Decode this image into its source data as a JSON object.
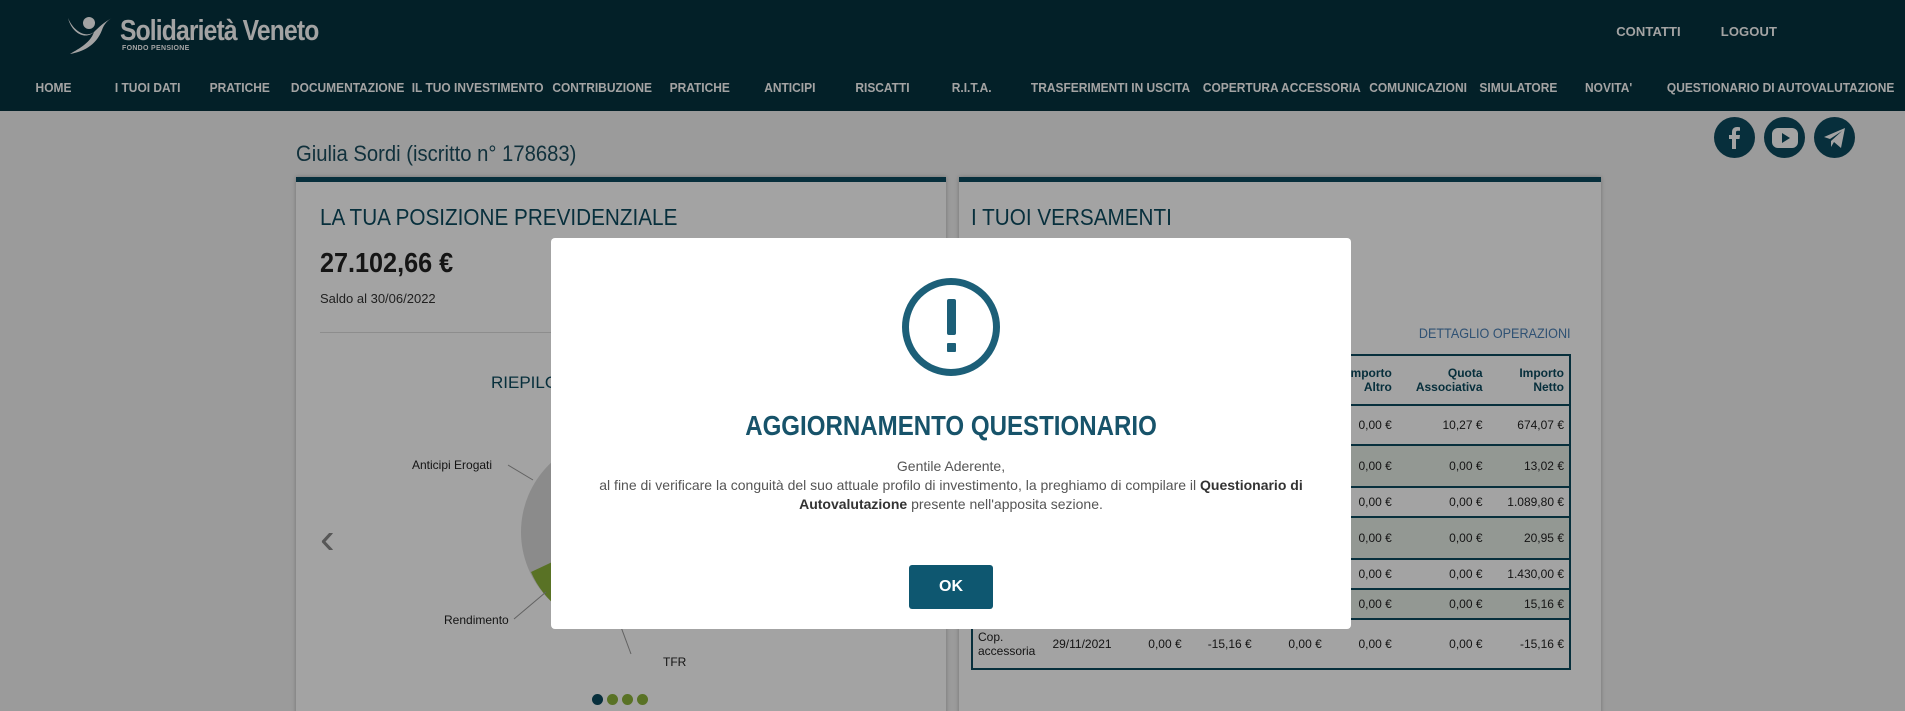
{
  "brand": {
    "name": "Solidarietà Veneto",
    "subtitle": "FONDO PENSIONE"
  },
  "top_links": [
    "CONTATTI",
    "LOGOUT"
  ],
  "nav": [
    "HOME",
    "I TUOI DATI",
    "PRATICHE",
    "DOCUMENTAZIONE",
    "IL TUO INVESTIMENTO",
    "CONTRIBUZIONE",
    "PRATICHE",
    "ANTICIPI",
    "RISCATTI",
    "R.I.T.A.",
    "TRASFERIMENTI IN USCITA",
    "COPERTURA ACCESSORIA",
    "COMUNICAZIONI",
    "SIMULATORE",
    "NOVITA'",
    "QUESTIONARIO DI AUTOVALUTAZIONE"
  ],
  "user": {
    "name": "Giulia Sordi (iscritto n° 178683)"
  },
  "social": [
    "facebook-icon",
    "youtube-icon",
    "telegram-icon"
  ],
  "position": {
    "title": "LA TUA POSIZIONE PREVIDENZIALE",
    "balance": "27.102,66  €",
    "date": "Saldo al 30/06/2022",
    "recap": "RIEPILOG",
    "chart_labels": [
      "Anticipi Erogati",
      "Rendimento",
      "TFR"
    ]
  },
  "payments": {
    "title": "I TUOI VERSAMENTI",
    "detail_link": "DETTAGLIO OPERAZIONI",
    "headers": [
      "Importo Altro",
      "Quota Associativa",
      "Importo Netto"
    ],
    "rows": [
      {
        "cells": [
          "0,00 €",
          "10,27 €",
          "674,07 €"
        ]
      },
      {
        "cells": [
          "0,00 €",
          "0,00 €",
          "13,02 €"
        ]
      },
      {
        "cells": [
          "0,00 €",
          "0,00 €",
          "1.089,80 €"
        ]
      },
      {
        "cells": [
          "0,00 €",
          "0,00 €",
          "20,95 €"
        ]
      },
      {
        "cells": [
          "0,00 €",
          "0,00 €",
          "1.430,00 €"
        ]
      },
      {
        "cells": [
          "0,00 €",
          "0,00 €",
          "15,16 €"
        ]
      }
    ],
    "last_row": [
      "Cop. accessoria",
      "29/11/2021",
      "0,00 €",
      "-15,16 €",
      "0,00 €",
      "0,00 €",
      "0,00 €",
      "-15,16 €"
    ]
  },
  "modal": {
    "title": "AGGIORNAMENTO QUESTIONARIO",
    "greeting": "Gentile Aderente,",
    "text_before": "al fine di verificare la conguità del suo attuale profilo di investimento, la preghiamo di compilare il",
    "text_bold": "Questionario di Autovalutazione",
    "text_after": "presente nell'apposita sezione.",
    "ok_label": "OK"
  }
}
